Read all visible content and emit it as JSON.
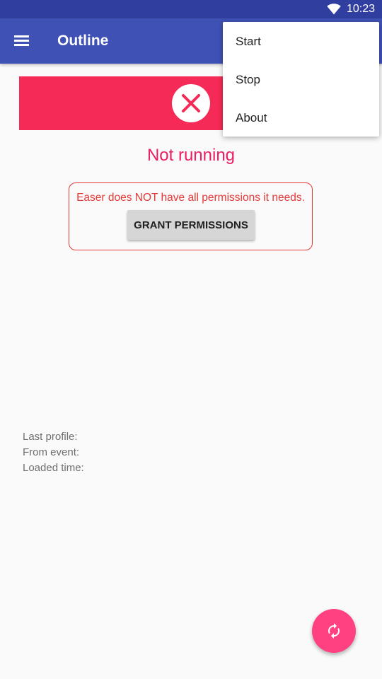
{
  "status_bar": {
    "time": "10:23",
    "wifi_icon": "wifi-icon"
  },
  "app_bar": {
    "menu_icon": "hamburger-menu-icon",
    "title": "Outline"
  },
  "status": {
    "icon": "close-circle-icon",
    "banner_color": "#f62a56",
    "text": "Not running",
    "text_color": "#e91e63"
  },
  "permissions": {
    "message": "Easer does NOT have all permissions it needs.",
    "button_label": "GRANT PERMISSIONS",
    "border_color": "#e53935"
  },
  "info": {
    "last_profile_label": "Last profile:",
    "from_event_label": "From event:",
    "loaded_time_label": "Loaded time:"
  },
  "fab": {
    "icon": "refresh-icon",
    "color": "#ff4081"
  },
  "overflow_menu": {
    "items": [
      {
        "label": "Start"
      },
      {
        "label": "Stop"
      },
      {
        "label": "About"
      }
    ]
  }
}
